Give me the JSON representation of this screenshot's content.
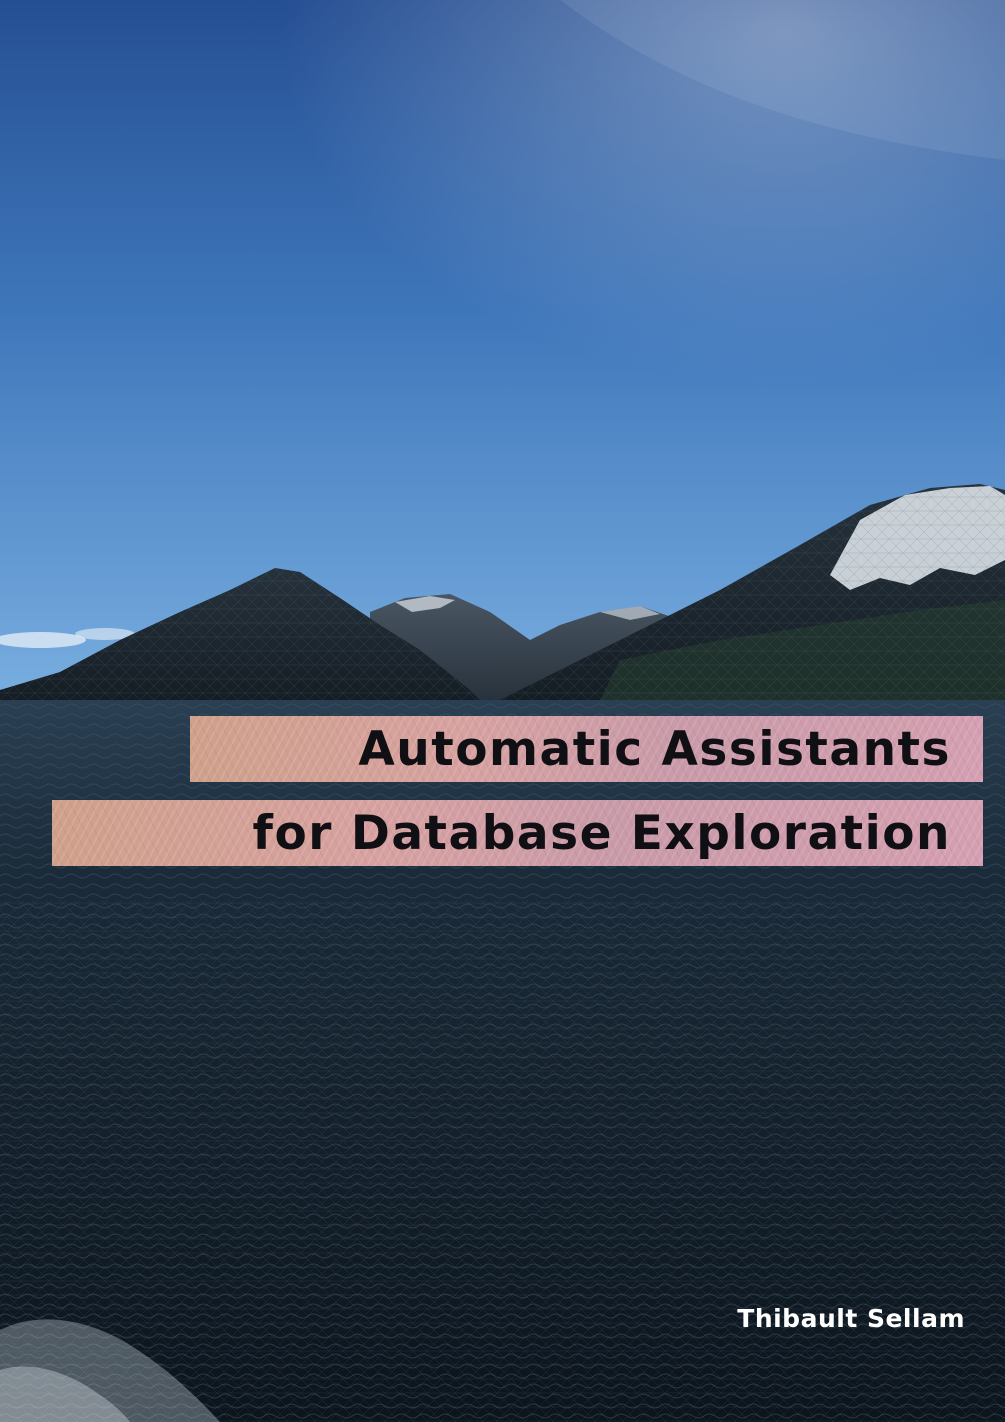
{
  "cover": {
    "title_line_1": "Automatic Assistants",
    "title_line_2": "for Database Exploration",
    "author": "Thibault Sellam"
  },
  "colors": {
    "sky_top": "#2f5fa6",
    "sky_horizon": "#6ea6d8",
    "mountain": "#1c2730",
    "sea": "#15222e",
    "title_band": "#d4a09c",
    "title_text": "#101014",
    "author_text": "#ffffff"
  }
}
